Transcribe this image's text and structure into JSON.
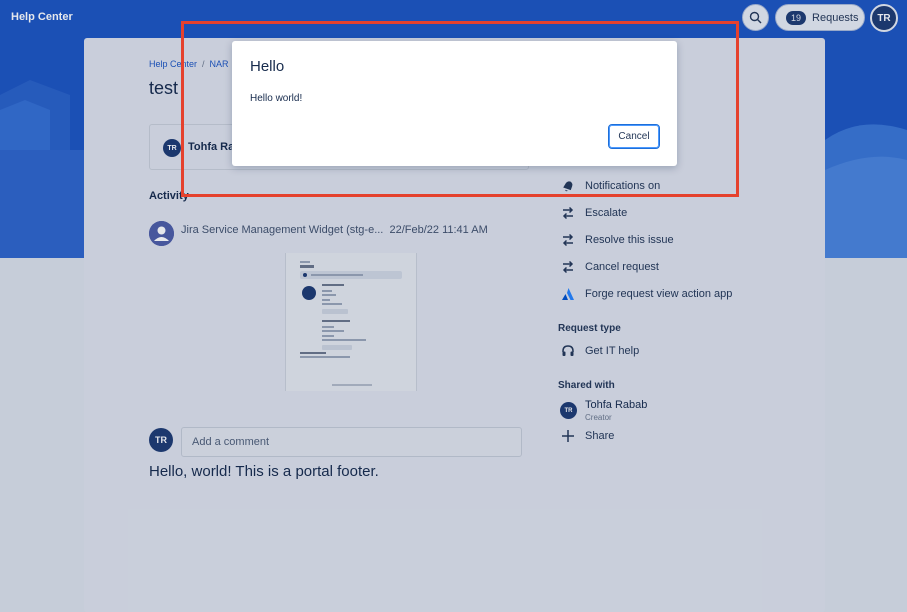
{
  "colors": {
    "banner": "#1e56c2",
    "accent": "#1e56c2",
    "highlight": "#e5412d",
    "avatar": "#1f3b73"
  },
  "topbar": {
    "brand": "Help Center",
    "requests_count": "19",
    "requests_label": "Requests",
    "user_initials": "TR"
  },
  "breadcrumb": {
    "items": [
      "Help Center",
      "NAR"
    ]
  },
  "page": {
    "title": "test"
  },
  "status": {
    "user_initials": "TR",
    "user_name": "Tohfa Rab"
  },
  "activity": {
    "heading": "Activity",
    "entry_source": "Jira Service Management Widget (stg-e...",
    "entry_timestamp": "22/Feb/22 11:41 AM"
  },
  "comment": {
    "user_initials": "TR",
    "placeholder": "Add a comment"
  },
  "footer": {
    "text": "Hello, world! This is a portal footer."
  },
  "actions": [
    {
      "label": "Notifications on",
      "icon": "bell-icon"
    },
    {
      "label": "Escalate",
      "icon": "transition-icon"
    },
    {
      "label": "Resolve this issue",
      "icon": "transition-icon"
    },
    {
      "label": "Cancel request",
      "icon": "transition-icon"
    },
    {
      "label": "Forge request view action app",
      "icon": "atlassian-logo-icon"
    }
  ],
  "request_type": {
    "heading": "Request type",
    "value": "Get IT help",
    "icon": "headset-icon"
  },
  "shared_with": {
    "heading": "Shared with",
    "user_initials": "TR",
    "user_name": "Tohfa Rabab",
    "user_role": "Creator",
    "share_label": "Share"
  },
  "dialog": {
    "title": "Hello",
    "body": "Hello world!",
    "cancel_label": "Cancel"
  }
}
